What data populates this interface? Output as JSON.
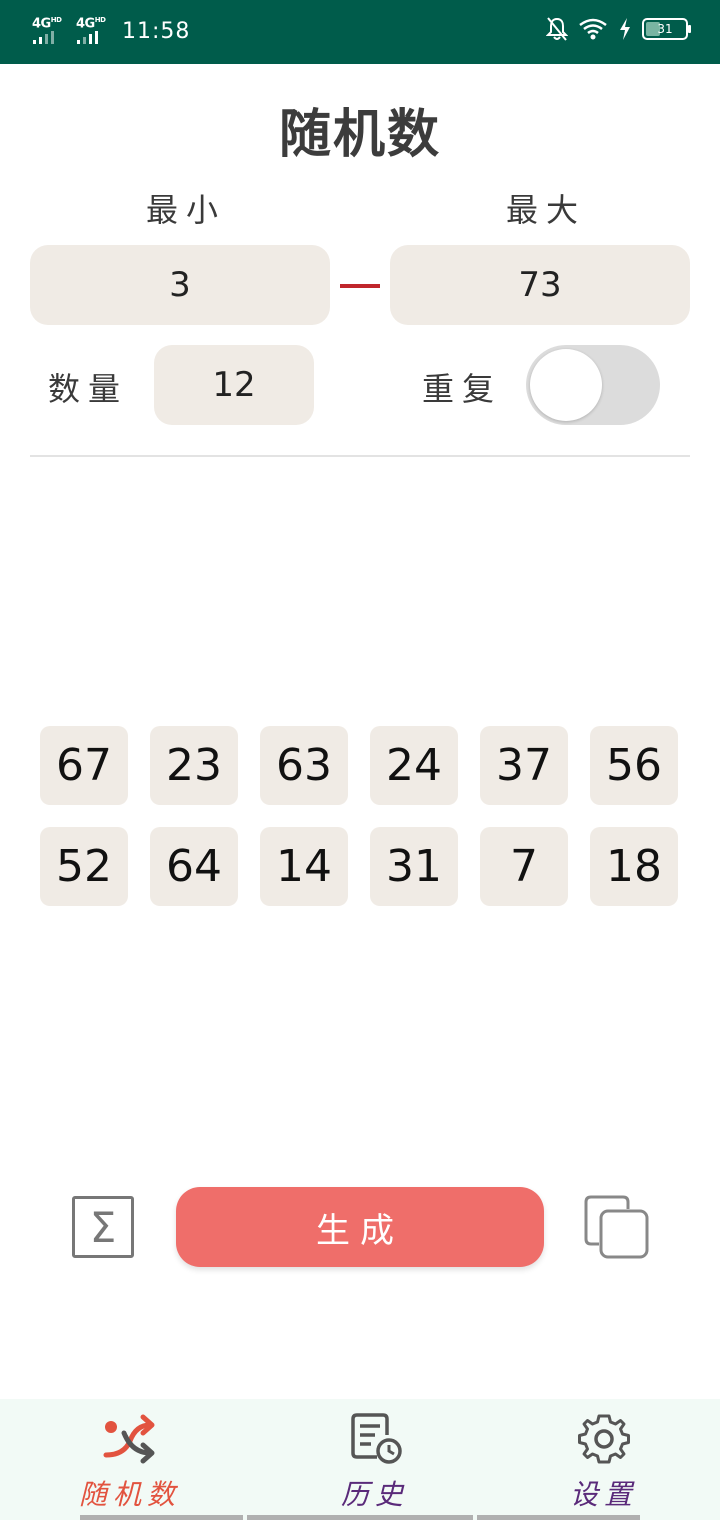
{
  "status_bar": {
    "network_1": "4G",
    "network_2": "4G",
    "network_sup": "HD",
    "time": "11:58",
    "battery": "31",
    "icons": [
      "mute-bell-icon",
      "wifi-icon",
      "charging-icon",
      "battery-icon"
    ]
  },
  "page": {
    "title": "随机数"
  },
  "range": {
    "min_label": "最小",
    "max_label": "最大",
    "min_value": "3",
    "max_value": "73",
    "dash_color": "#c0262c"
  },
  "options": {
    "count_label": "数量",
    "count_value": "12",
    "repeat_label": "重复",
    "repeat_on": false
  },
  "results": [
    "67",
    "23",
    "63",
    "24",
    "37",
    "56",
    "52",
    "64",
    "14",
    "31",
    "7",
    "18"
  ],
  "actions": {
    "sum_icon": "sigma-icon",
    "generate_label": "生成",
    "copy_icon": "copy-icon",
    "generate_color": "#ef6e6a"
  },
  "nav": {
    "items": [
      {
        "label": "随机数",
        "icon": "shuffle-icon",
        "active": true,
        "color": "#e2533f"
      },
      {
        "label": "历史",
        "icon": "history-icon",
        "active": false,
        "color": "#5a2a7a"
      },
      {
        "label": "设置",
        "icon": "gear-icon",
        "active": false,
        "color": "#5a2a7a"
      }
    ]
  },
  "colors": {
    "status_bar": "#005c4b",
    "field_bg": "#f0ebe5",
    "nav_bg": "#f2faf6"
  }
}
